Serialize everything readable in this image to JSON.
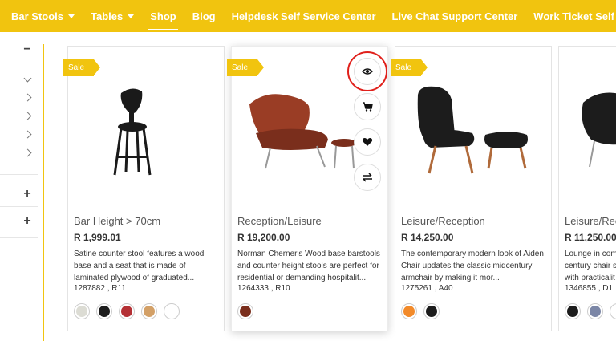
{
  "nav": {
    "items": [
      {
        "label": "Bar Stools",
        "dropdown": true
      },
      {
        "label": "Tables",
        "dropdown": true
      },
      {
        "label": "Shop",
        "active": true
      },
      {
        "label": "Blog"
      },
      {
        "label": "Helpdesk Self Service Center"
      },
      {
        "label": "Live Chat Support Center"
      },
      {
        "label": "Work Ticket Self Service Center"
      }
    ]
  },
  "sidebar": {
    "icons": [
      "minus-icon",
      "chevron-down-icon",
      "chevron-right-icon",
      "chevron-right-icon",
      "chevron-right-icon",
      "chevron-right-icon",
      "plus-icon",
      "plus-icon"
    ]
  },
  "badges": {
    "sale": "Sale"
  },
  "colors": {
    "accent": "#f1c40f",
    "highlight": "#e0201b"
  },
  "products": [
    {
      "category": "Bar Height > 70cm",
      "price": "R 1,999.01",
      "description": "Satine counter stool features a wood base and a seat that is made of laminated plywood of graduated...",
      "sku": "1287882 , R11",
      "swatches": [
        "#dcdcd4",
        "#1c1c1c",
        "#b43035",
        "#d3a067",
        "#ffffff"
      ]
    },
    {
      "category": "Reception/Leisure",
      "price": "R 19,200.00",
      "description": "Norman Cherner's Wood base barstools and counter height stools are perfect for residential or demanding hospitalit...",
      "sku": "1264333 , R10",
      "swatches": [
        "#7a2e1c"
      ]
    },
    {
      "category": "Leisure/Reception",
      "price": "R 14,250.00",
      "description": "The contemporary modern look of Aiden Chair updates the classic midcentury armchair by making it mor...",
      "sku": "1275261 , A40",
      "swatches": [
        "#f28a2a",
        "#1c1c1c"
      ]
    },
    {
      "category": "Leisure/Rec",
      "price": "R 11,250.00",
      "description": "Lounge in com century chair s with practicalit",
      "sku": "1346855 , D1",
      "swatches": [
        "#1c1c1c",
        "#7b86a6",
        "#ffffff"
      ]
    }
  ],
  "actions": [
    "quick-view",
    "add-to-cart",
    "wishlist",
    "compare"
  ]
}
